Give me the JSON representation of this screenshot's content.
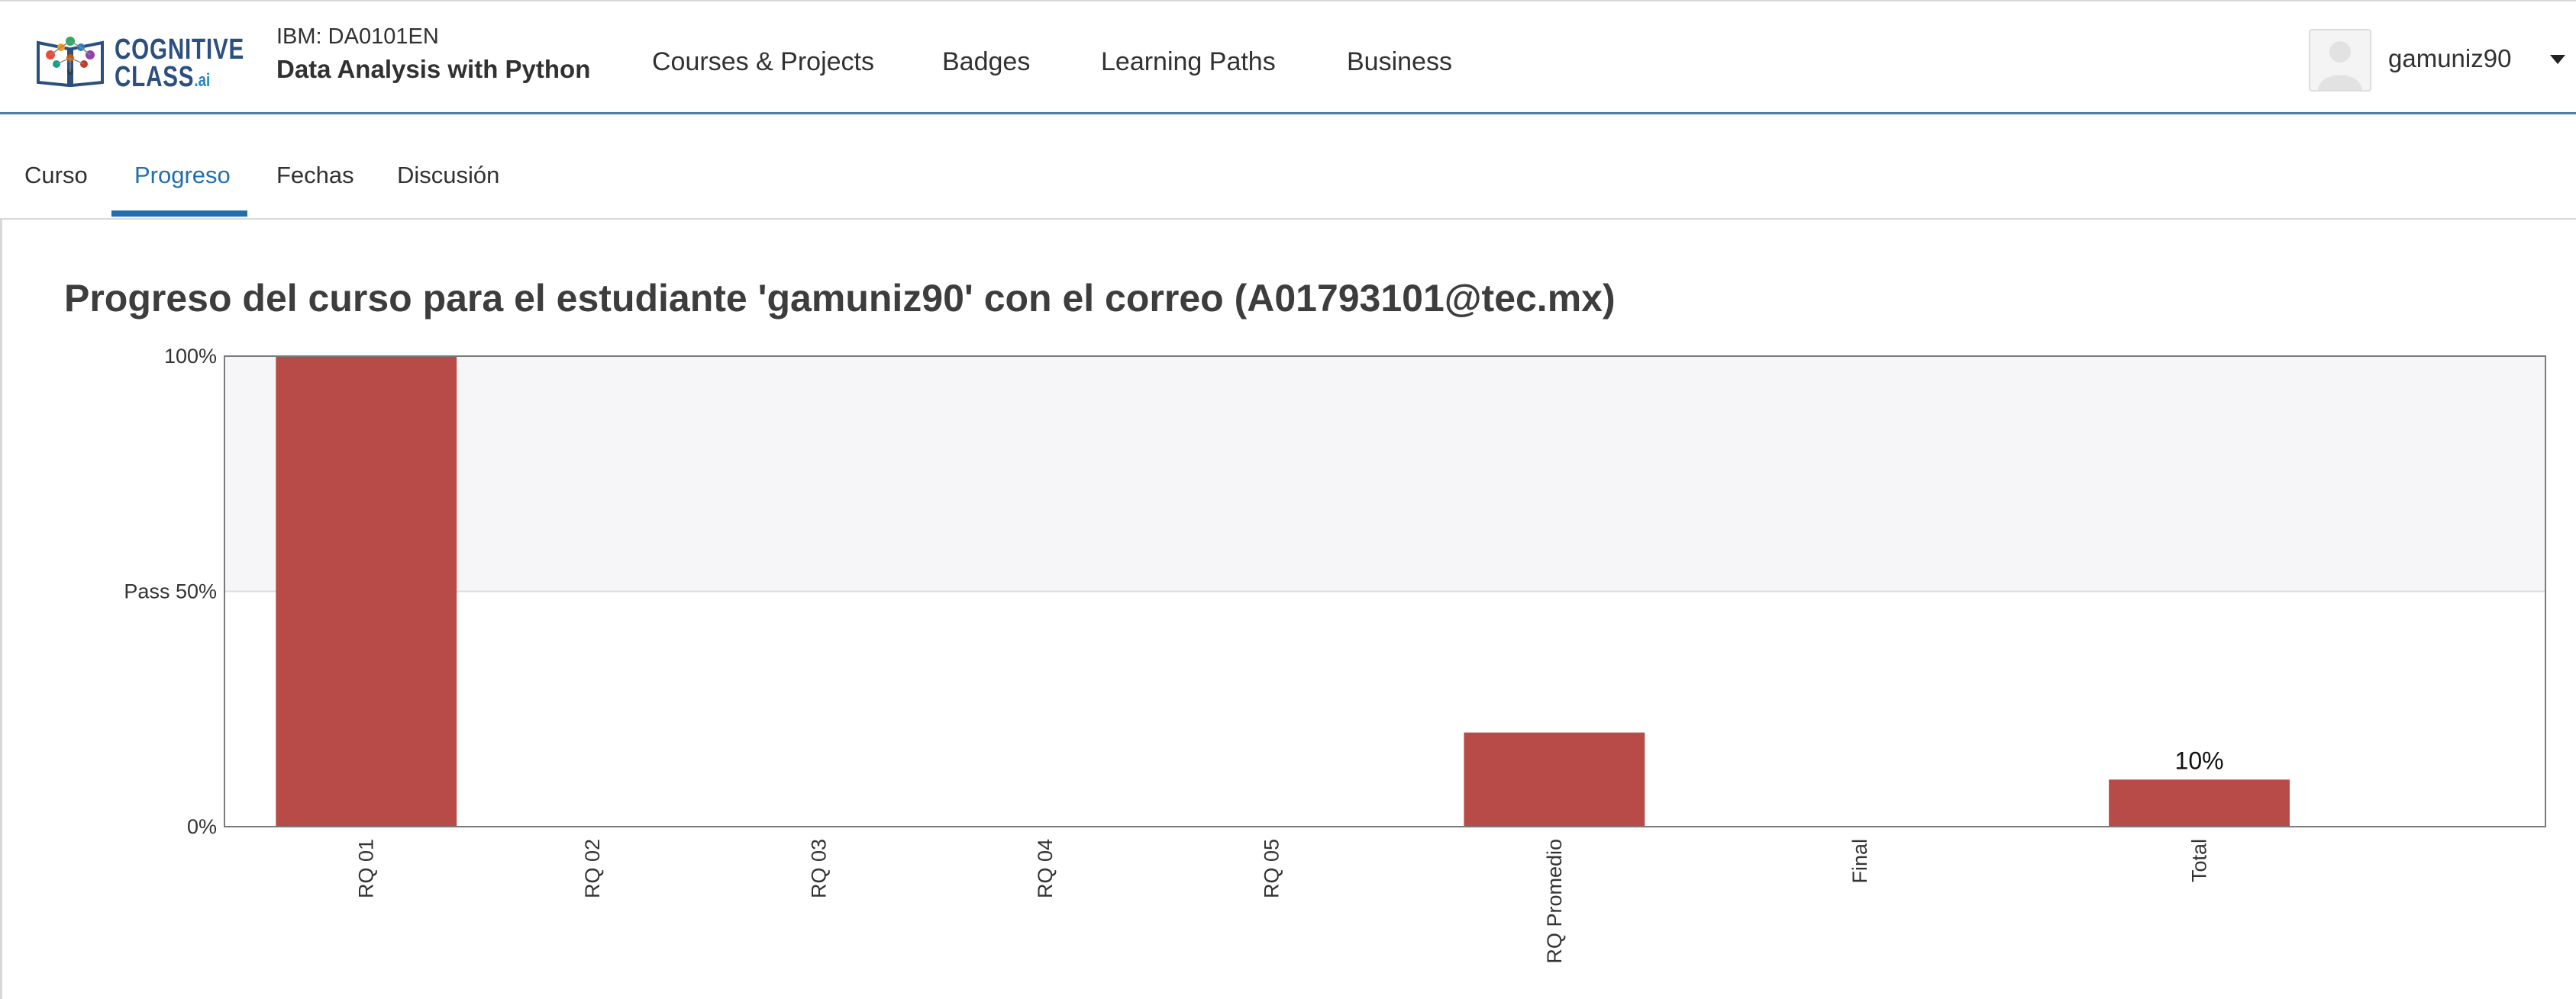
{
  "header": {
    "logo": {
      "line1": "COGNITIVE",
      "line2": "CLASS",
      "suffix": ".ai"
    },
    "course_code": "IBM: DA0101EN",
    "course_title": "Data Analysis with Python",
    "nav": [
      {
        "label": "Courses & Projects"
      },
      {
        "label": "Badges"
      },
      {
        "label": "Learning Paths"
      },
      {
        "label": "Business"
      }
    ],
    "user": {
      "username": "gamuniz90",
      "avatar_icon": "user-avatar-icon",
      "menu_icon": "caret-down-icon"
    }
  },
  "tabs": [
    {
      "label": "Curso",
      "active": false
    },
    {
      "label": "Progreso",
      "active": true
    },
    {
      "label": "Fechas",
      "active": false
    },
    {
      "label": "Discusión",
      "active": false
    }
  ],
  "page": {
    "title": "Progreso del curso para el estudiante 'gamuniz90' con el correo (A01793101@tec.mx)"
  },
  "colors": {
    "accent": "#1f6fae",
    "header_border": "#4f7ea3",
    "bar": "#b84a47",
    "pass_band": "#f6f6f8"
  },
  "chart_data": {
    "type": "bar",
    "categories": [
      "RQ 01",
      "RQ 02",
      "RQ 03",
      "RQ 04",
      "RQ 05",
      "RQ Promedio",
      "Final",
      "Total"
    ],
    "values": [
      100,
      0,
      0,
      0,
      0,
      20,
      0,
      10
    ],
    "unit": "%",
    "ylim": [
      0,
      100
    ],
    "yticks": [
      {
        "value": 100,
        "label": "100%"
      },
      {
        "value": 50,
        "label": "Pass 50%"
      },
      {
        "value": 0,
        "label": "0%"
      }
    ],
    "pass_threshold": 50,
    "data_labels": [
      {
        "category": "Total",
        "label": "10%"
      }
    ],
    "grid": false,
    "legend": "none"
  }
}
